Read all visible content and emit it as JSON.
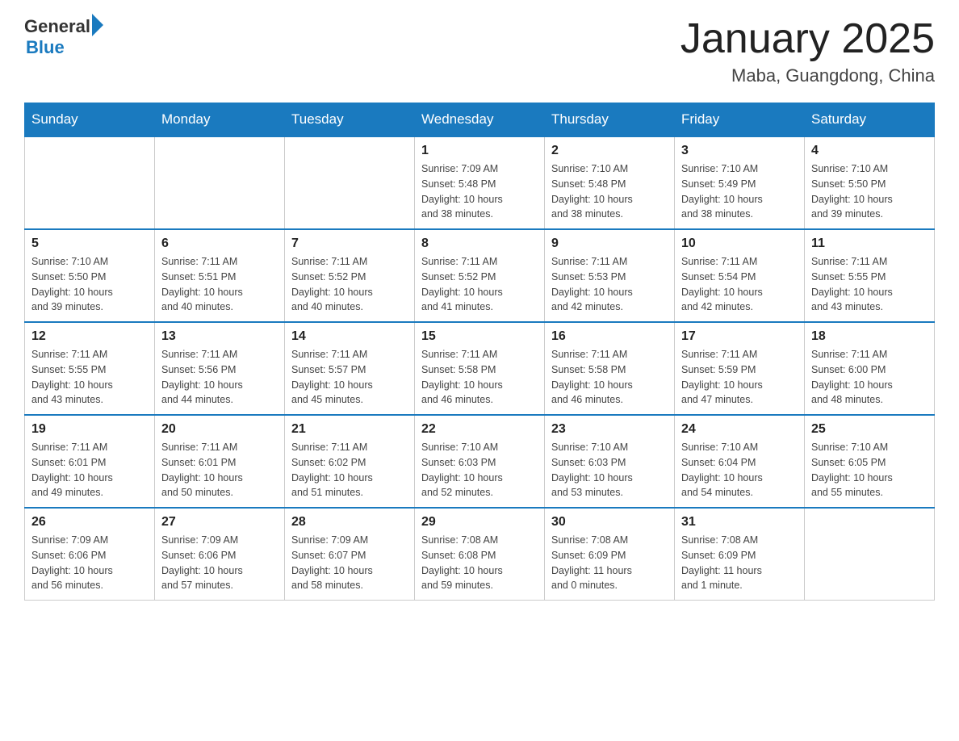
{
  "header": {
    "logo_general": "General",
    "logo_blue": "Blue",
    "month": "January 2025",
    "location": "Maba, Guangdong, China"
  },
  "days_of_week": [
    "Sunday",
    "Monday",
    "Tuesday",
    "Wednesday",
    "Thursday",
    "Friday",
    "Saturday"
  ],
  "weeks": [
    [
      {
        "day": "",
        "info": ""
      },
      {
        "day": "",
        "info": ""
      },
      {
        "day": "",
        "info": ""
      },
      {
        "day": "1",
        "info": "Sunrise: 7:09 AM\nSunset: 5:48 PM\nDaylight: 10 hours\nand 38 minutes."
      },
      {
        "day": "2",
        "info": "Sunrise: 7:10 AM\nSunset: 5:48 PM\nDaylight: 10 hours\nand 38 minutes."
      },
      {
        "day": "3",
        "info": "Sunrise: 7:10 AM\nSunset: 5:49 PM\nDaylight: 10 hours\nand 38 minutes."
      },
      {
        "day": "4",
        "info": "Sunrise: 7:10 AM\nSunset: 5:50 PM\nDaylight: 10 hours\nand 39 minutes."
      }
    ],
    [
      {
        "day": "5",
        "info": "Sunrise: 7:10 AM\nSunset: 5:50 PM\nDaylight: 10 hours\nand 39 minutes."
      },
      {
        "day": "6",
        "info": "Sunrise: 7:11 AM\nSunset: 5:51 PM\nDaylight: 10 hours\nand 40 minutes."
      },
      {
        "day": "7",
        "info": "Sunrise: 7:11 AM\nSunset: 5:52 PM\nDaylight: 10 hours\nand 40 minutes."
      },
      {
        "day": "8",
        "info": "Sunrise: 7:11 AM\nSunset: 5:52 PM\nDaylight: 10 hours\nand 41 minutes."
      },
      {
        "day": "9",
        "info": "Sunrise: 7:11 AM\nSunset: 5:53 PM\nDaylight: 10 hours\nand 42 minutes."
      },
      {
        "day": "10",
        "info": "Sunrise: 7:11 AM\nSunset: 5:54 PM\nDaylight: 10 hours\nand 42 minutes."
      },
      {
        "day": "11",
        "info": "Sunrise: 7:11 AM\nSunset: 5:55 PM\nDaylight: 10 hours\nand 43 minutes."
      }
    ],
    [
      {
        "day": "12",
        "info": "Sunrise: 7:11 AM\nSunset: 5:55 PM\nDaylight: 10 hours\nand 43 minutes."
      },
      {
        "day": "13",
        "info": "Sunrise: 7:11 AM\nSunset: 5:56 PM\nDaylight: 10 hours\nand 44 minutes."
      },
      {
        "day": "14",
        "info": "Sunrise: 7:11 AM\nSunset: 5:57 PM\nDaylight: 10 hours\nand 45 minutes."
      },
      {
        "day": "15",
        "info": "Sunrise: 7:11 AM\nSunset: 5:58 PM\nDaylight: 10 hours\nand 46 minutes."
      },
      {
        "day": "16",
        "info": "Sunrise: 7:11 AM\nSunset: 5:58 PM\nDaylight: 10 hours\nand 46 minutes."
      },
      {
        "day": "17",
        "info": "Sunrise: 7:11 AM\nSunset: 5:59 PM\nDaylight: 10 hours\nand 47 minutes."
      },
      {
        "day": "18",
        "info": "Sunrise: 7:11 AM\nSunset: 6:00 PM\nDaylight: 10 hours\nand 48 minutes."
      }
    ],
    [
      {
        "day": "19",
        "info": "Sunrise: 7:11 AM\nSunset: 6:01 PM\nDaylight: 10 hours\nand 49 minutes."
      },
      {
        "day": "20",
        "info": "Sunrise: 7:11 AM\nSunset: 6:01 PM\nDaylight: 10 hours\nand 50 minutes."
      },
      {
        "day": "21",
        "info": "Sunrise: 7:11 AM\nSunset: 6:02 PM\nDaylight: 10 hours\nand 51 minutes."
      },
      {
        "day": "22",
        "info": "Sunrise: 7:10 AM\nSunset: 6:03 PM\nDaylight: 10 hours\nand 52 minutes."
      },
      {
        "day": "23",
        "info": "Sunrise: 7:10 AM\nSunset: 6:03 PM\nDaylight: 10 hours\nand 53 minutes."
      },
      {
        "day": "24",
        "info": "Sunrise: 7:10 AM\nSunset: 6:04 PM\nDaylight: 10 hours\nand 54 minutes."
      },
      {
        "day": "25",
        "info": "Sunrise: 7:10 AM\nSunset: 6:05 PM\nDaylight: 10 hours\nand 55 minutes."
      }
    ],
    [
      {
        "day": "26",
        "info": "Sunrise: 7:09 AM\nSunset: 6:06 PM\nDaylight: 10 hours\nand 56 minutes."
      },
      {
        "day": "27",
        "info": "Sunrise: 7:09 AM\nSunset: 6:06 PM\nDaylight: 10 hours\nand 57 minutes."
      },
      {
        "day": "28",
        "info": "Sunrise: 7:09 AM\nSunset: 6:07 PM\nDaylight: 10 hours\nand 58 minutes."
      },
      {
        "day": "29",
        "info": "Sunrise: 7:08 AM\nSunset: 6:08 PM\nDaylight: 10 hours\nand 59 minutes."
      },
      {
        "day": "30",
        "info": "Sunrise: 7:08 AM\nSunset: 6:09 PM\nDaylight: 11 hours\nand 0 minutes."
      },
      {
        "day": "31",
        "info": "Sunrise: 7:08 AM\nSunset: 6:09 PM\nDaylight: 11 hours\nand 1 minute."
      },
      {
        "day": "",
        "info": ""
      }
    ]
  ]
}
